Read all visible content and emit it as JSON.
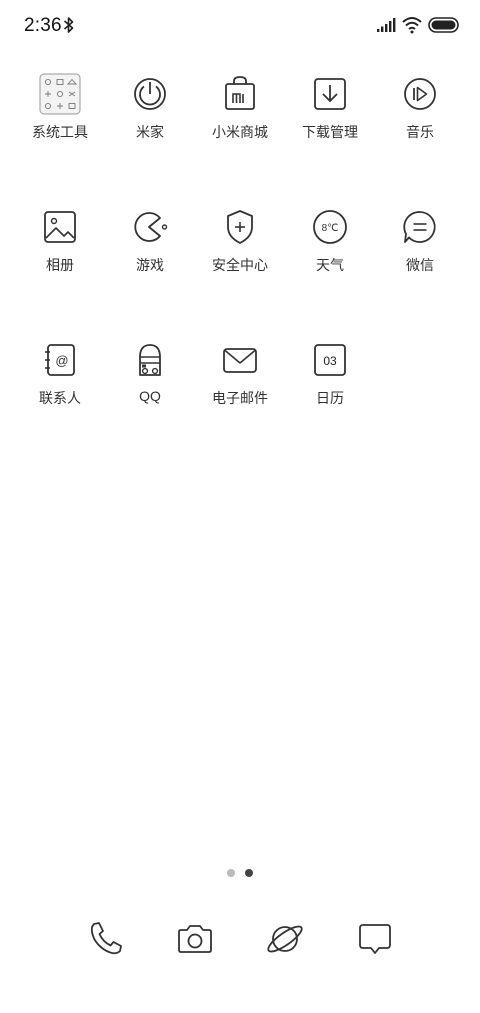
{
  "status_bar": {
    "time": "2:36",
    "bluetooth_icon": "bluetooth-icon",
    "signal_icon": "cellular-signal-icon",
    "wifi_icon": "wifi-icon",
    "battery_icon": "battery-icon"
  },
  "apps": [
    {
      "label": "系统工具",
      "icon": "folder-system-tools-icon"
    },
    {
      "label": "米家",
      "icon": "power-icon"
    },
    {
      "label": "小米商城",
      "icon": "shopping-bag-icon"
    },
    {
      "label": "下载管理",
      "icon": "download-icon"
    },
    {
      "label": "音乐",
      "icon": "music-play-icon"
    },
    {
      "label": "相册",
      "icon": "gallery-icon"
    },
    {
      "label": "游戏",
      "icon": "pacman-game-icon"
    },
    {
      "label": "安全中心",
      "icon": "shield-plus-icon"
    },
    {
      "label": "天气",
      "icon": "weather-icon",
      "icon_text": "8℃"
    },
    {
      "label": "微信",
      "icon": "chat-bubble-icon"
    },
    {
      "label": "联系人",
      "icon": "contacts-icon",
      "icon_text": "@"
    },
    {
      "label": "QQ",
      "icon": "qq-icon"
    },
    {
      "label": "电子邮件",
      "icon": "mail-icon"
    },
    {
      "label": "日历",
      "icon": "calendar-icon",
      "icon_text": "03"
    }
  ],
  "page_indicator": {
    "pages": 2,
    "current": 2
  },
  "dock": [
    {
      "icon": "phone-icon"
    },
    {
      "icon": "camera-icon"
    },
    {
      "icon": "browser-planet-icon"
    },
    {
      "icon": "messages-icon"
    }
  ],
  "colors": {
    "background": "#ffffff",
    "icon_stroke": "#333333",
    "dot_inactive": "#bbbbbb",
    "dot_active": "#444444"
  }
}
